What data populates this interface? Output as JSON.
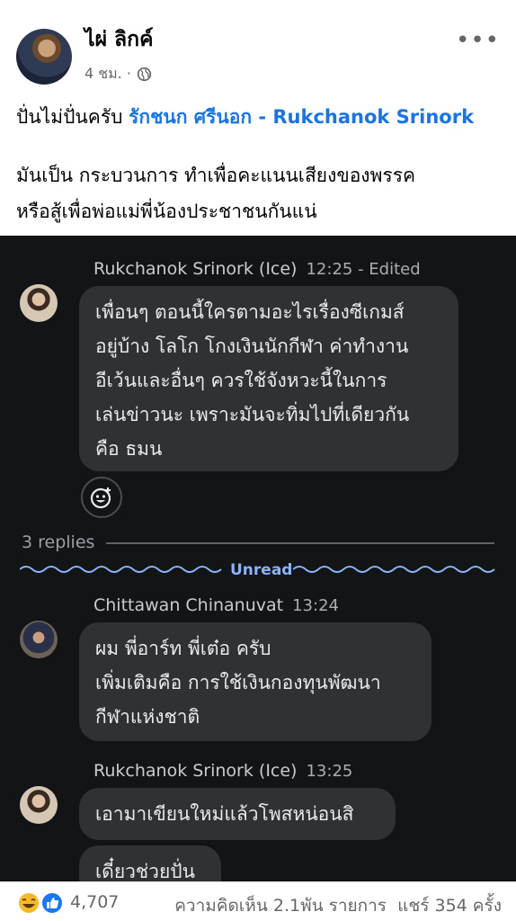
{
  "post": {
    "author": "ไผ่ ลิกค์",
    "time": "4 ชม. ·",
    "line1_prefix": "ปั่นไม่ปั่นครับ ",
    "line1_mention": "รักชนก ศรีนอก - Rukchanok Srinork",
    "line2": "มันเป็น กระบวนการ ทำเพื่อคะแนนเสียงของพรรค",
    "line3": "หรือสู้เพื่อพ่อแม่พี่น้องประชาชนกันแน่"
  },
  "chat": {
    "msg1": {
      "sender": "Rukchanok Srinork (Ice)",
      "time": "12:25 - Edited",
      "lines": [
        "เพื่อนๆ ตอนนี้ใครตามอะไรเรื่องซีเกมส์",
        "อยู่บ้าง โลโก โกงเงินนักกีฬา ค่าทำงาน",
        "อีเว้นและอื่นๆ ควรใช้จังหวะนี้ในการ",
        "เล่นข่าวนะ เพราะมันจะทิ่มไปที่เดียวกัน",
        "คือ ธมน"
      ]
    },
    "replies": "3 replies",
    "unread": "Unread",
    "msg2": {
      "sender": "Chittawan Chinanuvat",
      "time": "13:24",
      "lines": [
        "ผม พี่อาร์ท พี่เต๋อ ครับ",
        "เพิ่มเติมคือ การใช้เงินกองทุนพัฒนา",
        "กีฬาแห่งชาติ"
      ]
    },
    "msg3": {
      "sender": "Rukchanok Srinork (Ice)",
      "time": "13:25",
      "bubble1": "เอามาเขียนใหม่แล้วโพสหน่อนสิ",
      "bubble2": "เดี๋ยวช่วยปั่น"
    }
  },
  "footer": {
    "reactions": "4,707",
    "comments": "ความคิดเห็น 2.1พัน รายการ",
    "shares": "แชร์ 354 ครั้ง"
  },
  "colors": {
    "mention": "#1b74e4",
    "unread": "#8ab4f8",
    "chat_bg": "#131416",
    "bubble": "#2f3134"
  }
}
